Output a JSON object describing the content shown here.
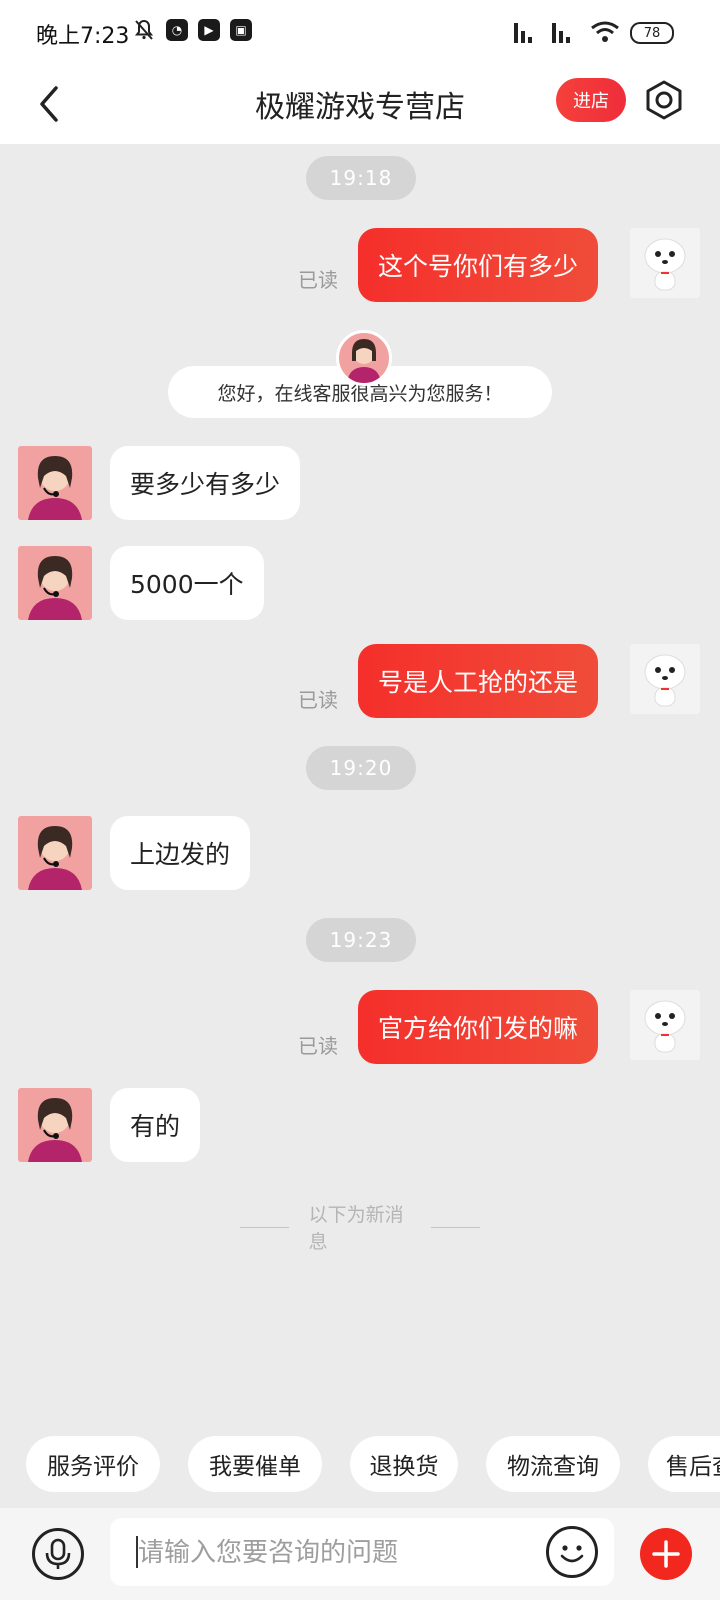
{
  "status_bar": {
    "time": "晚上7:23",
    "battery": "78"
  },
  "header": {
    "title": "极耀游戏专营店",
    "enter_store": "进店"
  },
  "chat": {
    "read_label": "已读",
    "times": [
      "19:18",
      "19:20",
      "19:23"
    ],
    "welcome": "您好，在线客服很高兴为您服务！",
    "messages": [
      {
        "side": "right",
        "text": "这个号你们有多少"
      },
      {
        "side": "left",
        "text": "要多少有多少"
      },
      {
        "side": "left",
        "text": "5000一个"
      },
      {
        "side": "right",
        "text": "号是人工抢的还是"
      },
      {
        "side": "left",
        "text": "上边发的"
      },
      {
        "side": "right",
        "text": "官方给你们发的嘛"
      },
      {
        "side": "left",
        "text": "有的"
      }
    ],
    "new_messages_divider": "以下为新消息"
  },
  "quick_replies": [
    "服务评价",
    "我要催单",
    "退换货",
    "物流查询",
    "售后查"
  ],
  "input": {
    "placeholder": "请输入您要咨询的问题"
  },
  "colors": {
    "accent": "#f5302c",
    "background": "#ebebeb"
  }
}
